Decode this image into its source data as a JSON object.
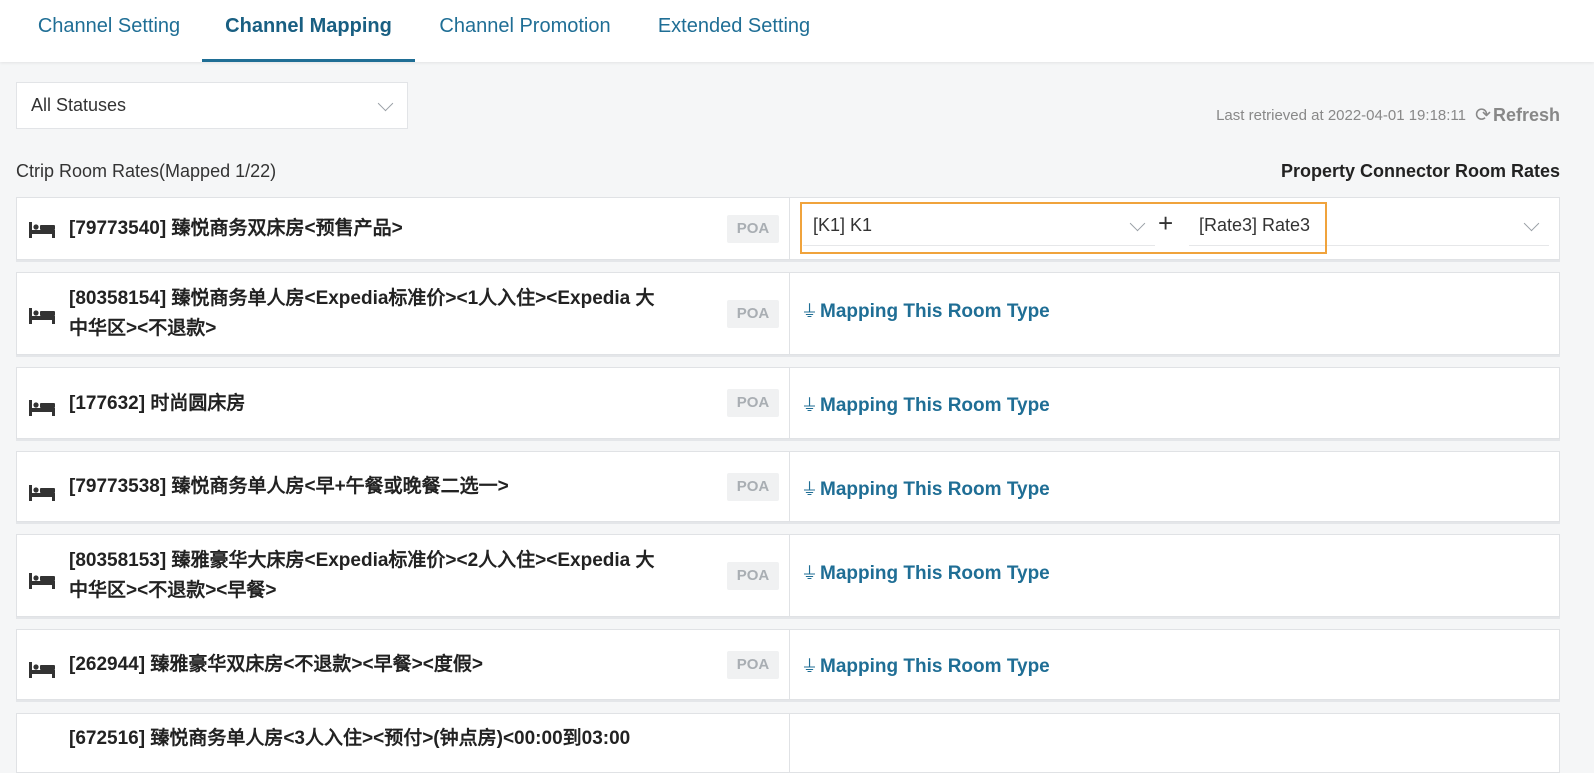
{
  "tabs": [
    {
      "label": "Channel Setting",
      "active": false
    },
    {
      "label": "Channel Mapping",
      "active": true
    },
    {
      "label": "Channel Promotion",
      "active": false
    },
    {
      "label": "Extended Setting",
      "active": false
    }
  ],
  "filter": {
    "status_value": "All Statuses"
  },
  "retrieved": {
    "text": "Last retrieved at 2022-04-01 19:18:11",
    "refresh_label": "Refresh"
  },
  "headers": {
    "left": "Ctrip Room Rates(Mapped 1/22)",
    "right": "Property Connector Room Rates"
  },
  "badge_label": "POA",
  "map_link_label": "Mapping This Room Type",
  "mapped": {
    "room_value": "[K1] K1",
    "plus": "+",
    "rate_value": "[Rate3] Rate3"
  },
  "rooms": [
    {
      "name": "[79773540] 臻悦商务双床房<预售产品>"
    },
    {
      "name": "[80358154] 臻悦商务单人房<Expedia标准价><1人入住><Expedia 大中华区><不退款>"
    },
    {
      "name": "[177632] 时尚圆床房"
    },
    {
      "name": "[79773538] 臻悦商务单人房<早+午餐或晚餐二选一>"
    },
    {
      "name": "[80358153] 臻雅豪华大床房<Expedia标准价><2人入住><Expedia 大中华区><不退款><早餐>"
    },
    {
      "name": "[262944] 臻雅豪华双床房<不退款><早餐><度假>"
    },
    {
      "name": "[672516] 臻悦商务单人房<3人入住><预付>(钟点房)<00:00到03:00"
    }
  ],
  "colors": {
    "accent": "#1f6e95",
    "highlight": "#f0a33c"
  },
  "icons": {
    "bed": "bed-icon",
    "plug": "plug-icon",
    "refresh": "refresh-icon"
  }
}
